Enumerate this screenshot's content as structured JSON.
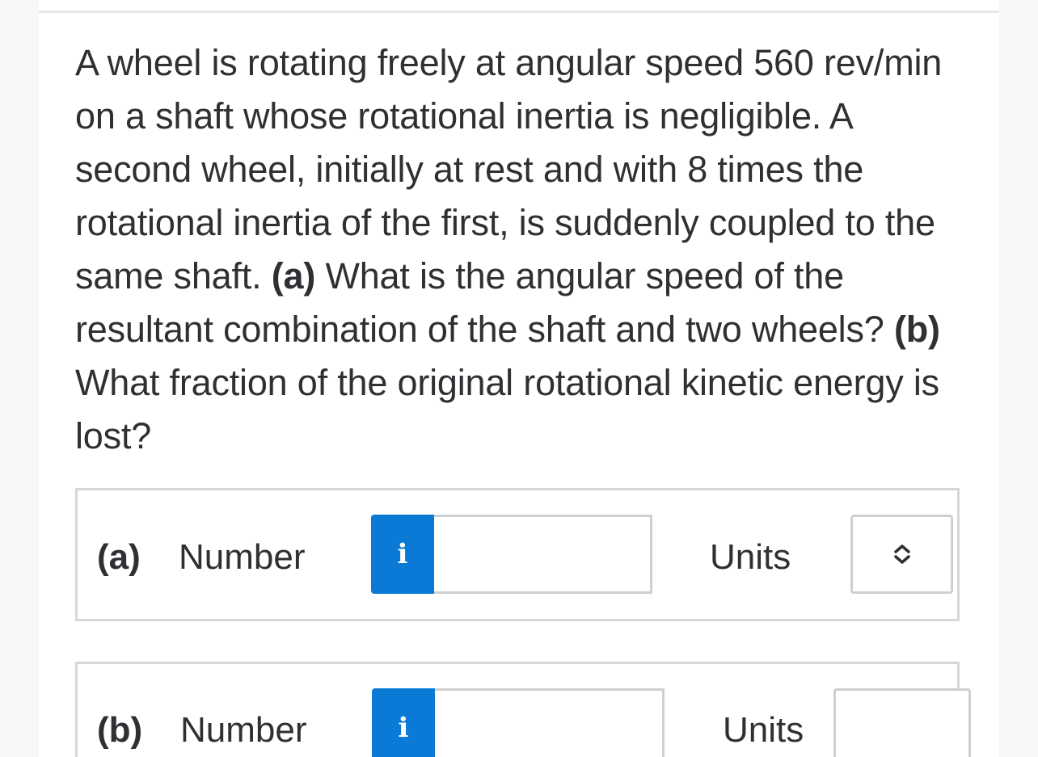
{
  "question": {
    "intro": "A wheel is rotating freely at angular speed 560 rev/min on a shaft whose rotational inertia is negligible. A second wheel, initially at rest and with 8 times the rotational inertia of the first, is suddenly coupled to the same shaft.",
    "part_a_marker": "(a)",
    "part_a_text": "What is the angular speed of the resultant combination of the shaft and two wheels?",
    "part_b_marker": "(b)",
    "part_b_text": "What fraction of the original rotational kinetic energy is lost?"
  },
  "answers": [
    {
      "part_label": "(a)",
      "number_label": "Number",
      "info_icon": "i",
      "number_value": "",
      "units_label": "Units",
      "units_selected": "",
      "units_icon": "chevron-up-down-icon"
    },
    {
      "part_label": "(b)",
      "number_label": "Number",
      "info_icon": "i",
      "number_value": "",
      "units_label": "Units",
      "units_selected": ""
    }
  ],
  "colors": {
    "info_button": "#0a7ad6",
    "text": "#2f3033",
    "border": "#d7d7d7"
  }
}
